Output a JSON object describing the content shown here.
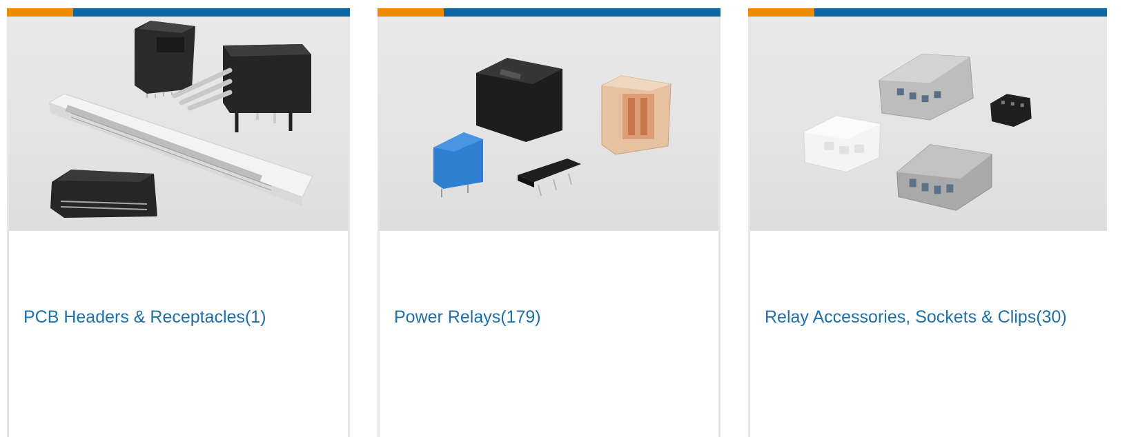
{
  "colors": {
    "accent_orange": "#f08a00",
    "accent_blue": "#0a67a3",
    "link_text": "#1f6fa8",
    "card_border": "#e6e6e6"
  },
  "cards": [
    {
      "title": "PCB Headers & Receptacles(1)",
      "image_icon": "pcb-headers-receptacles-image"
    },
    {
      "title": "Power Relays(179)",
      "image_icon": "power-relays-image"
    },
    {
      "title": "Relay Accessories, Sockets & Clips(30)",
      "image_icon": "relay-sockets-clips-image"
    }
  ]
}
